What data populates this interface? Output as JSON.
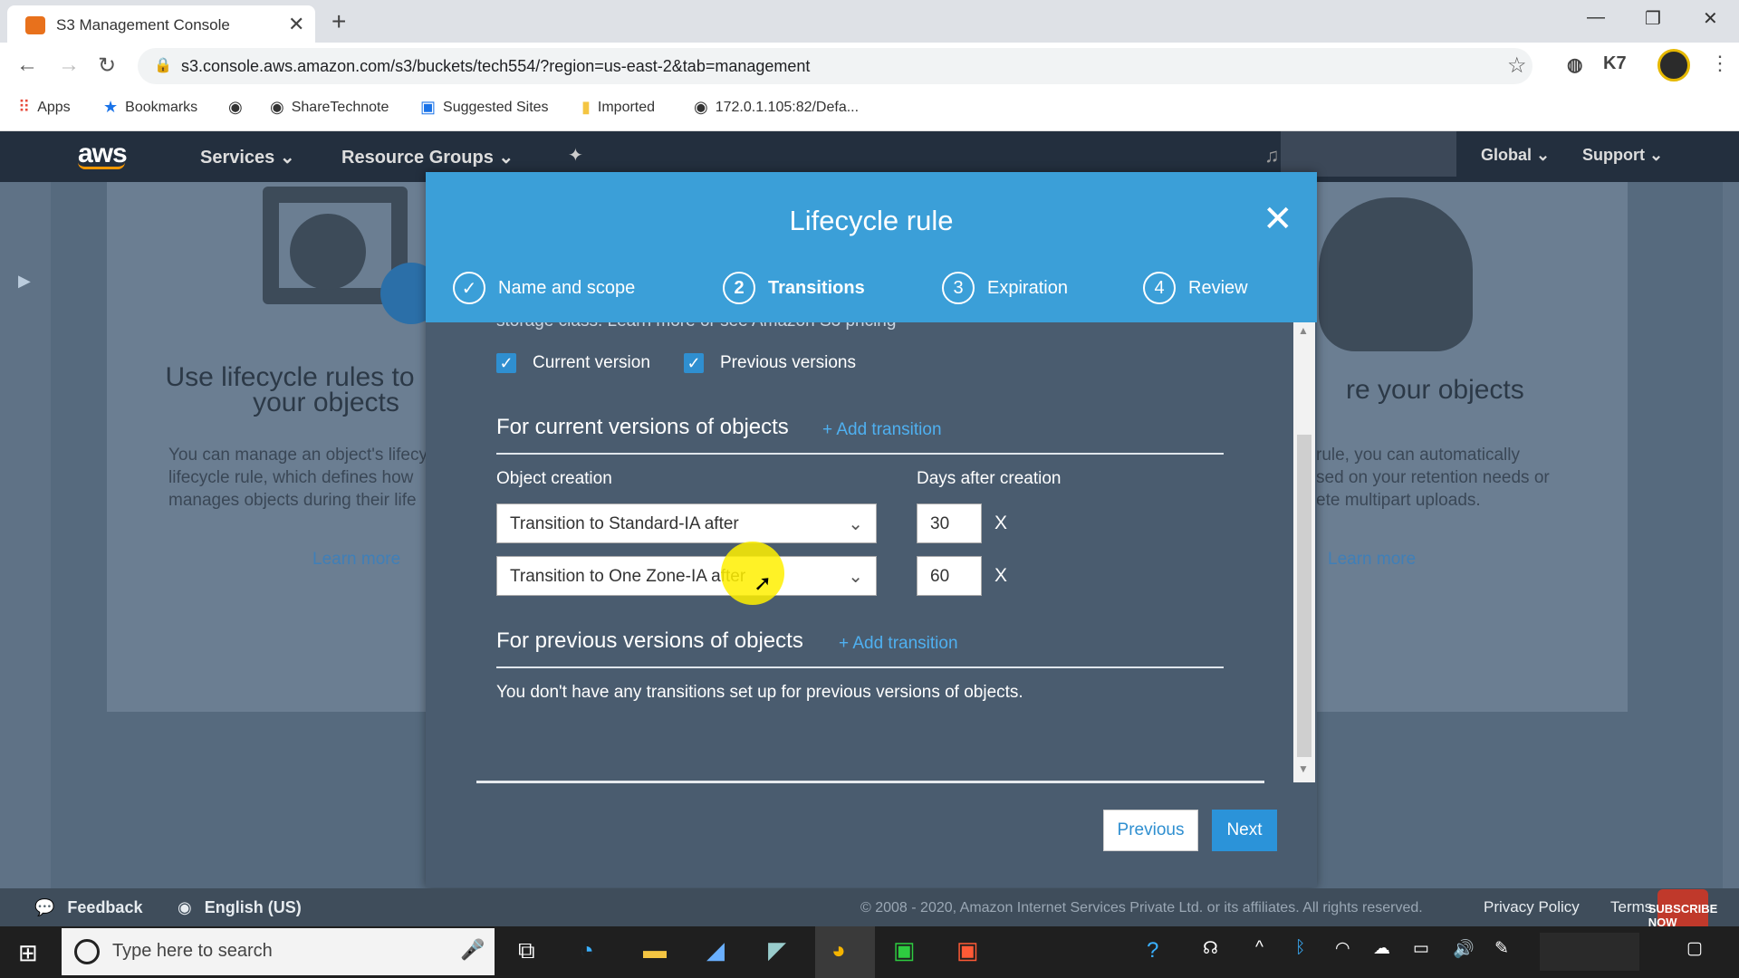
{
  "browser": {
    "tab_title": "S3 Management Console",
    "url": "s3.console.aws.amazon.com/s3/buckets/tech554/?region=us-east-2&tab=management",
    "bookmarks": [
      "Apps",
      "Bookmarks",
      "ShareTechnote",
      "Suggested Sites",
      "Imported",
      "172.0.1.105:82/Defa..."
    ]
  },
  "aws_nav": {
    "logo": "aws",
    "services": "Services",
    "resource_groups": "Resource Groups",
    "global": "Global",
    "support": "Support"
  },
  "background": {
    "left_title_1": "Use lifecycle rules to",
    "left_title_2": "your objects",
    "left_text_1": "You can manage an object's lifecy",
    "left_text_2": "lifecycle rule, which defines how",
    "left_text_3": "manages objects during their life",
    "left_link": "Learn more",
    "right_title": "re your objects",
    "right_text_1": "rule, you can automatically",
    "right_text_2": "sed on your retention needs or",
    "right_text_3": "ete multipart uploads.",
    "right_link": "Learn more"
  },
  "modal": {
    "title": "Lifecycle rule",
    "steps": [
      {
        "num": "✓",
        "label": "Name and scope"
      },
      {
        "num": "2",
        "label": "Transitions"
      },
      {
        "num": "3",
        "label": "Expiration"
      },
      {
        "num": "4",
        "label": "Review"
      }
    ],
    "storage_line": "storage class.  Learn more  or see  Amazon S3 pricing",
    "current_version_label": "Current version",
    "previous_versions_label": "Previous versions",
    "current_section_title": "For current versions of objects",
    "add_transition": "+ Add transition",
    "object_creation_header": "Object creation",
    "days_after_creation_header": "Days after creation",
    "transitions": [
      {
        "option": "Transition to Standard-IA after",
        "days": "30"
      },
      {
        "option": "Transition to One Zone-IA after",
        "days": "60"
      }
    ],
    "remove_mark": "X",
    "previous_section_title": "For previous versions of objects",
    "no_previous_text": "You don't have any transitions set up for previous versions of objects.",
    "previous_button": "Previous",
    "next_button": "Next"
  },
  "footer": {
    "feedback": "Feedback",
    "language": "English (US)",
    "copyright": "© 2008 - 2020, Amazon Internet Services Private Ltd. or its affiliates. All rights reserved.",
    "privacy": "Privacy Policy",
    "terms": "Terms"
  },
  "taskbar": {
    "search_placeholder": "Type here to search",
    "subscribe": "SUBSCRIBE NOW"
  }
}
